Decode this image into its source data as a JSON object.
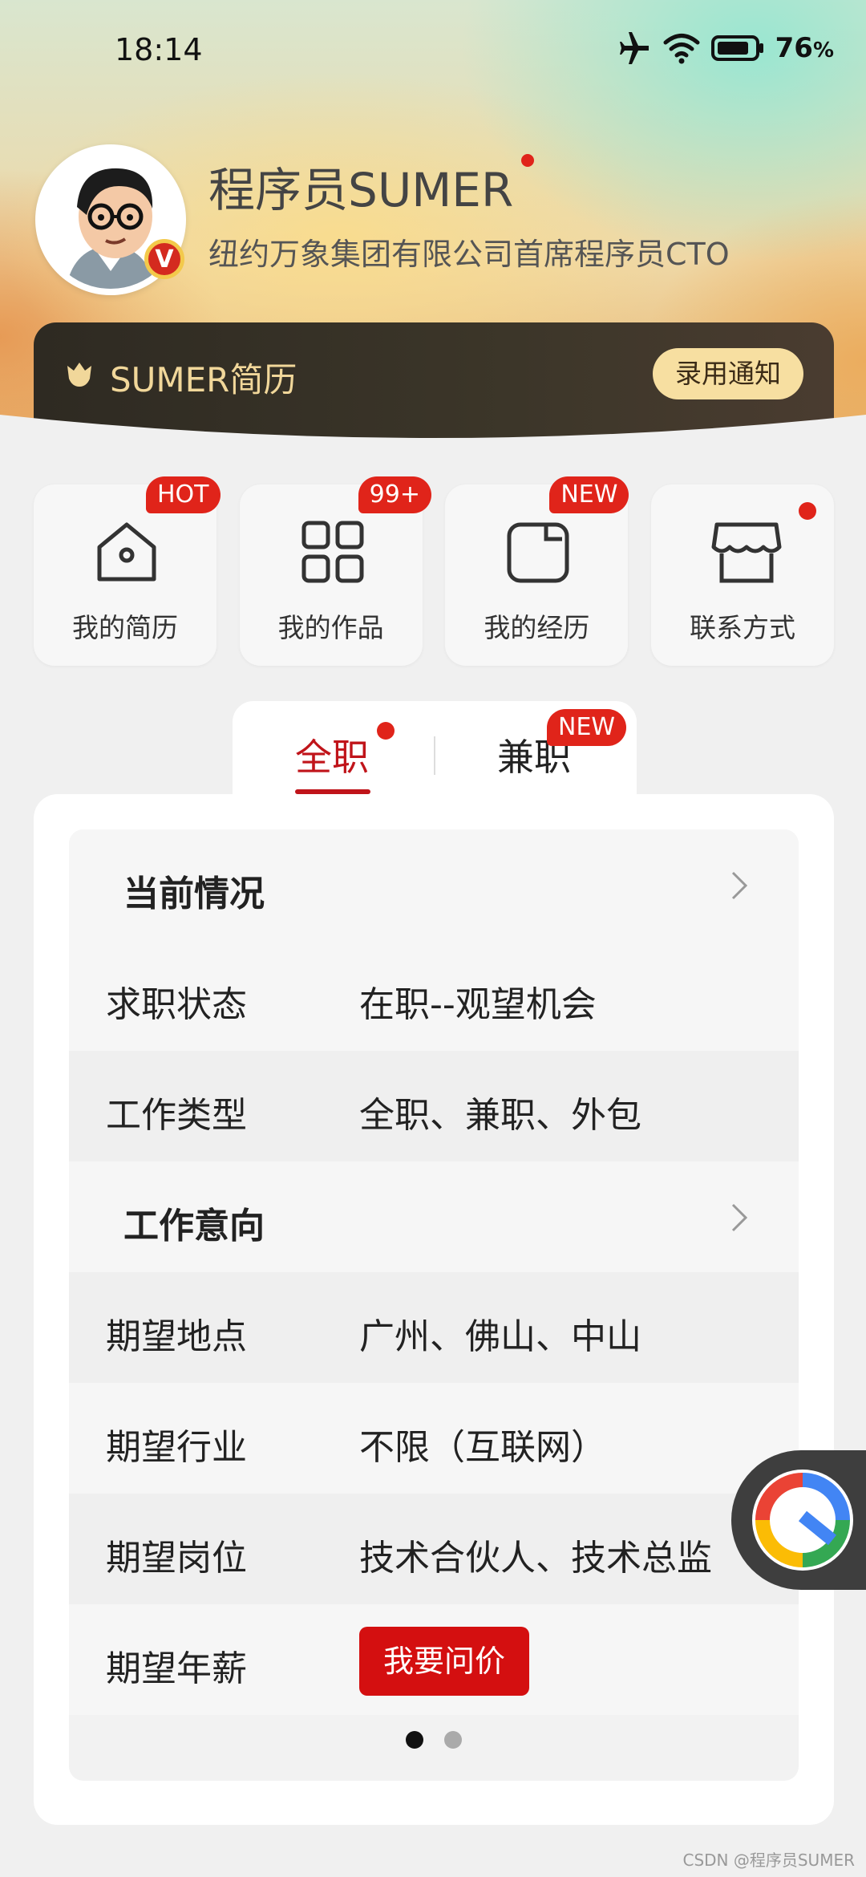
{
  "status_bar": {
    "time": "18:14",
    "battery": "76",
    "battery_unit": "%",
    "icons": [
      "airplane-icon",
      "wifi-icon",
      "battery-icon"
    ]
  },
  "profile": {
    "name": "程序员SUMER",
    "title": "纽约万象集团有限公司首席程序员CTO",
    "verified_badge": "V"
  },
  "banner": {
    "title": "SUMER简历",
    "button": "录用通知"
  },
  "shortcuts": [
    {
      "label": "我的简历",
      "badge": "HOT",
      "icon": "home-icon"
    },
    {
      "label": "我的作品",
      "badge": "99+",
      "icon": "grid-apps-icon"
    },
    {
      "label": "我的经历",
      "badge": "NEW",
      "icon": "briefcase-icon"
    },
    {
      "label": "联系方式",
      "badge": "",
      "icon": "store-icon"
    }
  ],
  "tabs": [
    {
      "label": "全职",
      "active": true
    },
    {
      "label": "兼职",
      "badge": "NEW"
    }
  ],
  "panel": {
    "section1": "当前情况",
    "rows1": [
      {
        "k": "求职状态",
        "v": "在职--观望机会"
      },
      {
        "k": "工作类型",
        "v": "全职、兼职、外包"
      }
    ],
    "section2": "工作意向",
    "rows2": [
      {
        "k": "期望地点",
        "v": "广州、佛山、中山"
      },
      {
        "k": "期望行业",
        "v": "不限（互联网）"
      },
      {
        "k": "期望岗位",
        "v": "技术合伙人、技术总监"
      }
    ],
    "salary_label": "期望年薪",
    "salary_button": "我要问价",
    "pages": 2,
    "current_page": 1
  },
  "watermark": "CSDN @程序员SUMER",
  "colors": {
    "accent": "#c0141a",
    "badge": "#e0241a",
    "banner_bg": "#2e2a22",
    "banner_text": "#f1d79a"
  }
}
